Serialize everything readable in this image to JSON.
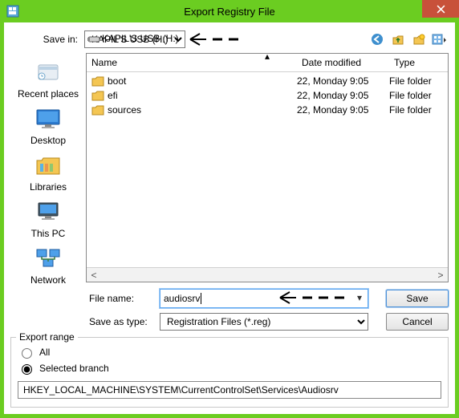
{
  "window_title": "Export Registry File",
  "savein": {
    "label": "Save in:",
    "selected": "KAPIL'S USB (H:)"
  },
  "places": [
    {
      "id": "recent",
      "label": "Recent places"
    },
    {
      "id": "desktop",
      "label": "Desktop"
    },
    {
      "id": "libraries",
      "label": "Libraries"
    },
    {
      "id": "thispc",
      "label": "This PC"
    },
    {
      "id": "network",
      "label": "Network"
    }
  ],
  "columns": {
    "name": "Name",
    "date": "Date modified",
    "type": "Type"
  },
  "rows": [
    {
      "name": "boot",
      "date": "22, Monday 9:05",
      "type": "File folder"
    },
    {
      "name": "efi",
      "date": "22, Monday 9:05",
      "type": "File folder"
    },
    {
      "name": "sources",
      "date": "22, Monday 9:05",
      "type": "File folder"
    }
  ],
  "filename_label": "File name:",
  "filename_value": "audiosrv",
  "savetype_label": "Save as type:",
  "savetype_selected": "Registration Files (*.reg)",
  "save_label": "Save",
  "cancel_label": "Cancel",
  "export_range": {
    "legend": "Export range",
    "all_label": "All",
    "selected_label": "Selected branch",
    "branch_path": "HKEY_LOCAL_MACHINE\\SYSTEM\\CurrentControlSet\\Services\\Audiosrv"
  },
  "icons": {
    "back": "back-icon",
    "up": "up-folder-icon",
    "newfolder": "new-folder-icon",
    "views": "views-icon"
  }
}
